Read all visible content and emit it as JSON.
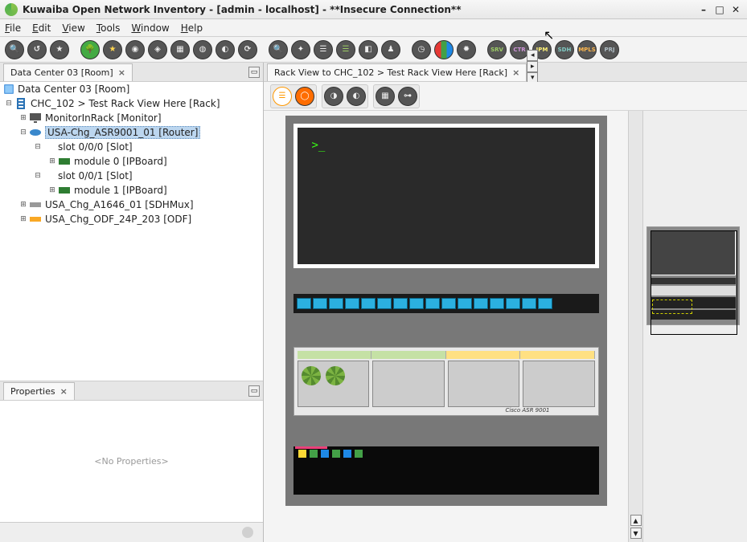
{
  "window": {
    "title": "Kuwaiba Open Network Inventory - [admin - localhost] - **Insecure Connection**"
  },
  "menu": [
    "File",
    "Edit",
    "View",
    "Tools",
    "Window",
    "Help"
  ],
  "main_toolbar_groups": [
    [
      "search",
      "history",
      "favorite"
    ],
    [
      "tree",
      "star",
      "network-1",
      "network-2",
      "grid",
      "globe",
      "audit",
      "sync"
    ],
    [
      "zoom",
      "nodes",
      "list-1",
      "list-2",
      "package",
      "user"
    ],
    [
      "clock-1",
      "chart",
      "clock-2"
    ],
    [
      "SRV",
      "CTR",
      "IPM",
      "SDH",
      "MPLS",
      "PRJ"
    ]
  ],
  "left_tab": {
    "title": "Data Center 03 [Room]"
  },
  "tree_title": "Data Center 03 [Room]",
  "tree": {
    "chc": "CHC_102 > Test Rack View Here [Rack]",
    "monitor": "MonitorInRack [Monitor]",
    "router": "USA-Chg_ASR9001_01 [Router]",
    "slot0": "slot 0/0/0 [Slot]",
    "mod0": "module 0 [IPBoard]",
    "slot1": "slot 0/0/1 [Slot]",
    "mod1": "module 1 [IPBoard]",
    "mux": "USA_Chg_A1646_01 [SDHMux]",
    "odf": "USA_Chg_ODF_24P_203 [ODF]"
  },
  "properties": {
    "title": "Properties",
    "empty": "<No Properties>"
  },
  "right_tab": {
    "title": "Rack View to CHC_102 > Test Rack View Here [Rack]"
  },
  "rack_view_toolbar": [
    "refresh",
    "circle-o",
    "pointer",
    "pan",
    "grid",
    "link"
  ],
  "monitor_prompt": ">_",
  "router_brand": "Cisco ASR 9001"
}
